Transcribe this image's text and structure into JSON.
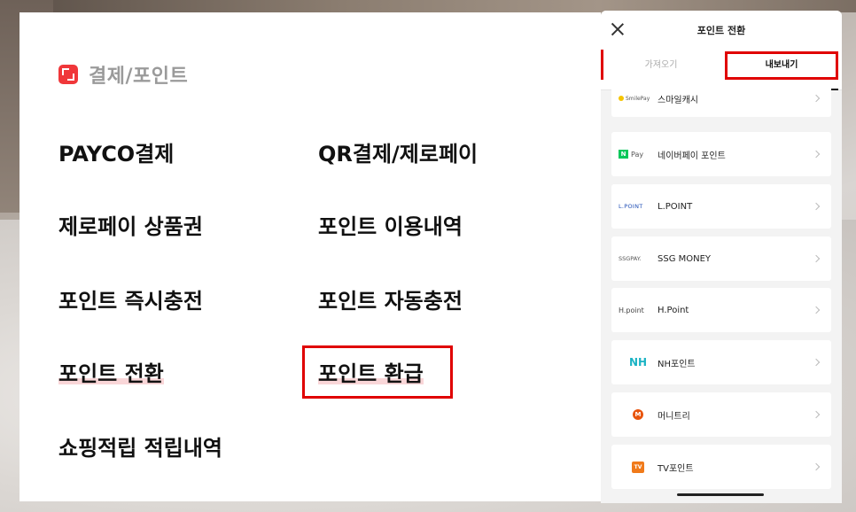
{
  "menu": {
    "title": "결제/포인트",
    "items": [
      {
        "label": "PAYCO결제"
      },
      {
        "label": "QR결제/제로페이"
      },
      {
        "label": "제로페이 상품권"
      },
      {
        "label": "포인트 이용내역"
      },
      {
        "label": "포인트 즉시충전"
      },
      {
        "label": "포인트 자동충전"
      },
      {
        "label": "포인트 전환"
      },
      {
        "label": "포인트 환급"
      },
      {
        "label": "쇼핑적립 적립내역"
      }
    ]
  },
  "sheet": {
    "title": "포인트 전환",
    "tabs": [
      {
        "label": "가져오기"
      },
      {
        "label": "내보내기"
      }
    ],
    "partners": [
      {
        "logo": "SmilePay",
        "name": "스마일캐시"
      },
      {
        "logo": "Pay",
        "logo_mark": "N",
        "name": "네이버페이 포인트"
      },
      {
        "logo": "L.POINT",
        "name": "L.POINT"
      },
      {
        "logo": "SSGPAY.",
        "name": "SSG MONEY"
      },
      {
        "logo": "H.point",
        "name": "H.Point"
      },
      {
        "logo": "NH",
        "name": "NH포인트"
      },
      {
        "logo": "M",
        "name": "머니트리"
      },
      {
        "logo": "TV",
        "name": "TV포인트"
      }
    ]
  }
}
